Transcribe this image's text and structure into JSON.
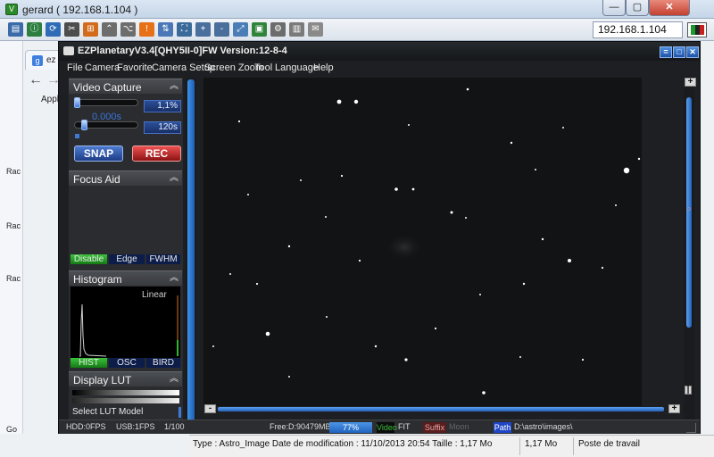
{
  "vnc": {
    "title": "gerard ( 192.168.1.104 )",
    "address": "192.168.1.104",
    "close_label": "✕",
    "min_label": "—",
    "max_label": "▢"
  },
  "toolbar_icons": [
    {
      "name": "connection-options-icon",
      "color": "#3b6aa8"
    },
    {
      "name": "connection-info-icon",
      "color": "#2c7f3f"
    },
    {
      "name": "refresh-icon",
      "color": "#2f6cb6"
    },
    {
      "name": "ctrl-alt-del-icon",
      "color": "#4d4d4d"
    },
    {
      "name": "windows-key-icon",
      "color": "#d36b1c"
    },
    {
      "name": "ctrl-key-icon",
      "color": "#6d6d6d"
    },
    {
      "name": "alt-key-icon",
      "color": "#6d6d6d"
    },
    {
      "name": "alert-icon",
      "color": "#e77117"
    },
    {
      "name": "file-transfer-icon",
      "color": "#4b77b6"
    },
    {
      "name": "fullscreen-icon",
      "color": "#3a6a9a"
    },
    {
      "name": "zoom-in-icon",
      "color": "#4a6f9c"
    },
    {
      "name": "zoom-out-icon",
      "color": "#4a6f9c"
    },
    {
      "name": "scale-icon",
      "color": "#4b7db7"
    },
    {
      "name": "save-icon",
      "color": "#30843a"
    },
    {
      "name": "options-icon",
      "color": "#6c6c6c"
    },
    {
      "name": "screenshot-icon",
      "color": "#7a7a7a"
    },
    {
      "name": "chat-icon",
      "color": "#8a8a8a"
    }
  ],
  "browser_behind": {
    "tab_label": "ez",
    "apps_label": "Applic",
    "side_labels": [
      "Rac",
      "Rac",
      "Rac",
      "Go"
    ]
  },
  "explorer_status": {
    "info": "Type : Astro_Image Date de modification : 11/10/2013 20:54 Taille  : 1,17 Mo",
    "size": "1,17 Mo",
    "location": "Poste de travail"
  },
  "ez": {
    "title": "EZPlanetaryV3.4[QHY5II-0]FW Version:12-8-4",
    "win_buttons": [
      "=",
      "□",
      "✕"
    ],
    "menu": [
      "File",
      "Camera",
      "Favorite",
      "Camera Setup",
      "Screen Zoom",
      "Tool",
      "Language",
      "Help"
    ],
    "video_capture": {
      "header": "Video Capture",
      "gain_value": "1,1%",
      "exposure_overlay": "0.000s",
      "exposure_value": "120s",
      "snap_label": "SNAP",
      "rec_label": "REC"
    },
    "focus_aid": {
      "header": "Focus Aid",
      "modes": [
        "Disable",
        "Edge",
        "FWHM"
      ]
    },
    "histogram": {
      "header": "Histogram",
      "scale_label": "Linear",
      "modes": [
        "HIST",
        "OSC",
        "BIRD"
      ]
    },
    "display_lut": {
      "header": "Display LUT",
      "model_label": "Select LUT Model"
    },
    "status": {
      "hdd": "HDD:0FPS",
      "usb": "USB:1FPS",
      "ratio": "1/100",
      "free": "Free:D:90479MB",
      "progress": "77%",
      "video_tag": "Video",
      "video_format": "FIT",
      "suffix_tag": "Suffix",
      "suffix_value": "Moon",
      "path_tag": "Path",
      "path_value": "D:\\astro\\images\\"
    },
    "zoom_plus": "+",
    "zoom_minus": "-",
    "colors": {
      "accent_blue": "#3e7bd8",
      "rec_red": "#c82020",
      "active_green": "#2fb52f"
    }
  }
}
